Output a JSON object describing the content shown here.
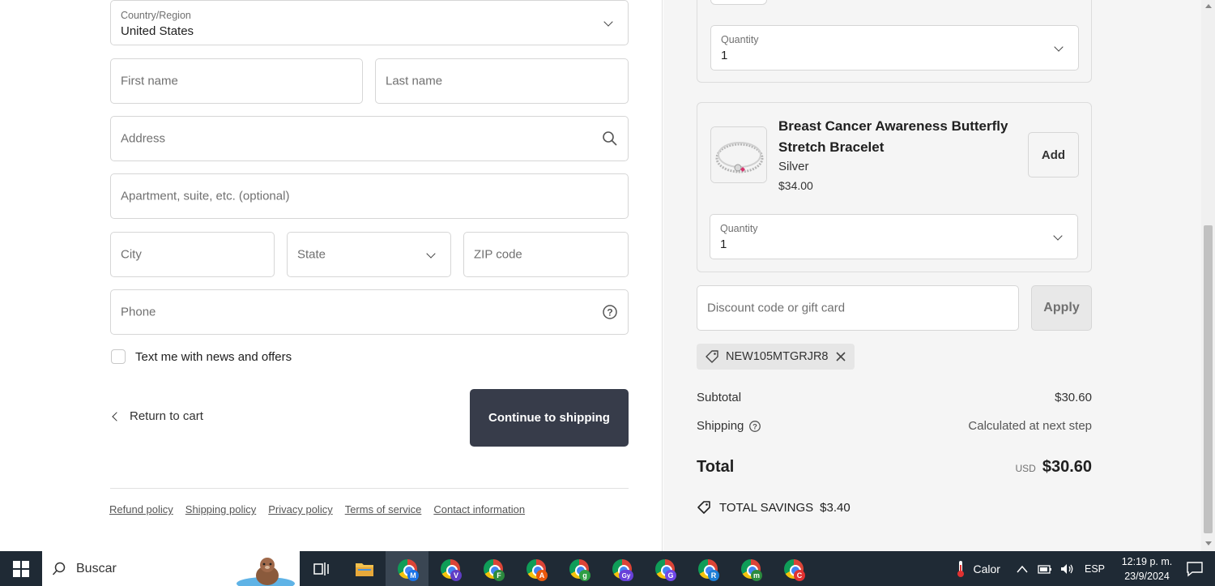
{
  "form": {
    "country": {
      "label": "Country/Region",
      "value": "United States"
    },
    "first_name_placeholder": "First name",
    "last_name_placeholder": "Last name",
    "address_placeholder": "Address",
    "apartment_placeholder": "Apartment, suite, etc. (optional)",
    "city_placeholder": "City",
    "state_placeholder": "State",
    "zip_placeholder": "ZIP code",
    "phone_placeholder": "Phone",
    "text_me_label": "Text me with news and offers",
    "return_label": "Return to cart",
    "continue_label": "Continue to shipping"
  },
  "footer_links": [
    "Refund policy",
    "Shipping policy",
    "Privacy policy",
    "Terms of service",
    "Contact information"
  ],
  "upsell": {
    "top_quantity": {
      "label": "Quantity",
      "value": "1"
    },
    "product": {
      "title": "Breast Cancer Awareness Butterfly Stretch Bracelet",
      "variant": "Silver",
      "price": "$34.00",
      "add_label": "Add",
      "quantity_label": "Quantity",
      "quantity_value": "1"
    }
  },
  "discount": {
    "placeholder": "Discount code or gift card",
    "apply_label": "Apply",
    "applied_code": "NEW105MTGRJR8"
  },
  "summary": {
    "subtotal_label": "Subtotal",
    "subtotal_value": "$30.60",
    "shipping_label": "Shipping",
    "shipping_value": "Calculated at next step",
    "total_label": "Total",
    "currency": "USD",
    "total_value": "$30.60",
    "savings_label": "TOTAL SAVINGS",
    "savings_value": "$3.40"
  },
  "taskbar": {
    "search_placeholder": "Buscar",
    "apps": [
      {
        "badge": "M",
        "color": "#1a73e8"
      },
      {
        "badge": "V",
        "color": "#5f3dc4"
      },
      {
        "badge": "F",
        "color": "#2b8a3e"
      },
      {
        "badge": "A",
        "color": "#e8590c"
      },
      {
        "badge": "g",
        "color": "#2f9e44"
      },
      {
        "badge": "Gy",
        "color": "#6741d9"
      },
      {
        "badge": "G",
        "color": "#7048e8"
      },
      {
        "badge": "R",
        "color": "#1c7ed6"
      },
      {
        "badge": "m",
        "color": "#2b8a3e"
      },
      {
        "badge": "C",
        "color": "#e03131"
      }
    ],
    "weather": "Calor",
    "language": "ESP",
    "time": "12:19 p. m.",
    "date": "23/9/2024"
  }
}
